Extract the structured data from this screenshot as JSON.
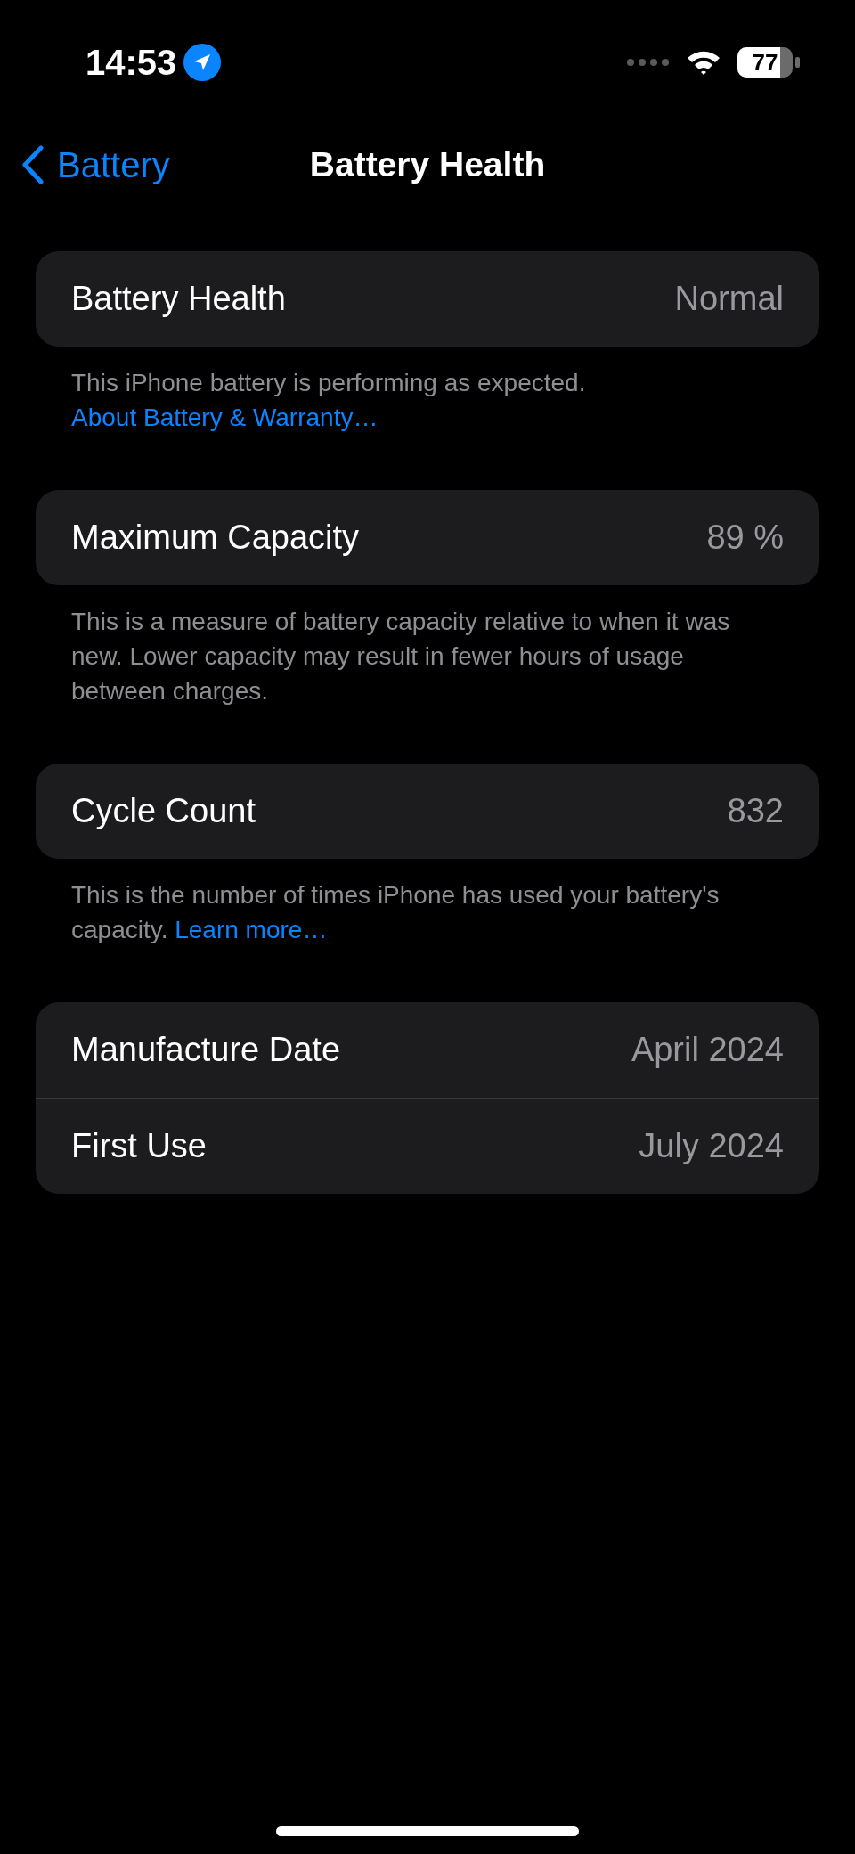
{
  "status_bar": {
    "time": "14:53",
    "battery": "77"
  },
  "nav": {
    "back": "Battery",
    "title": "Battery Health"
  },
  "sections": [
    {
      "rows": [
        {
          "label": "Battery Health",
          "value": "Normal"
        }
      ],
      "footer": {
        "text": "This iPhone battery is performing as expected.",
        "link": "About Battery & Warranty…"
      }
    },
    {
      "rows": [
        {
          "label": "Maximum Capacity",
          "value": "89 %"
        }
      ],
      "footer": {
        "text": "This is a measure of battery capacity relative to when it was new. Lower capacity may result in fewer hours of usage between charges."
      }
    },
    {
      "rows": [
        {
          "label": "Cycle Count",
          "value": "832"
        }
      ],
      "footer": {
        "text": "This is the number of times iPhone has used your battery's capacity.",
        "link": "Learn more…"
      }
    },
    {
      "rows": [
        {
          "label": "Manufacture Date",
          "value": "April 2024"
        },
        {
          "label": "First Use",
          "value": "July 2024"
        }
      ]
    }
  ]
}
